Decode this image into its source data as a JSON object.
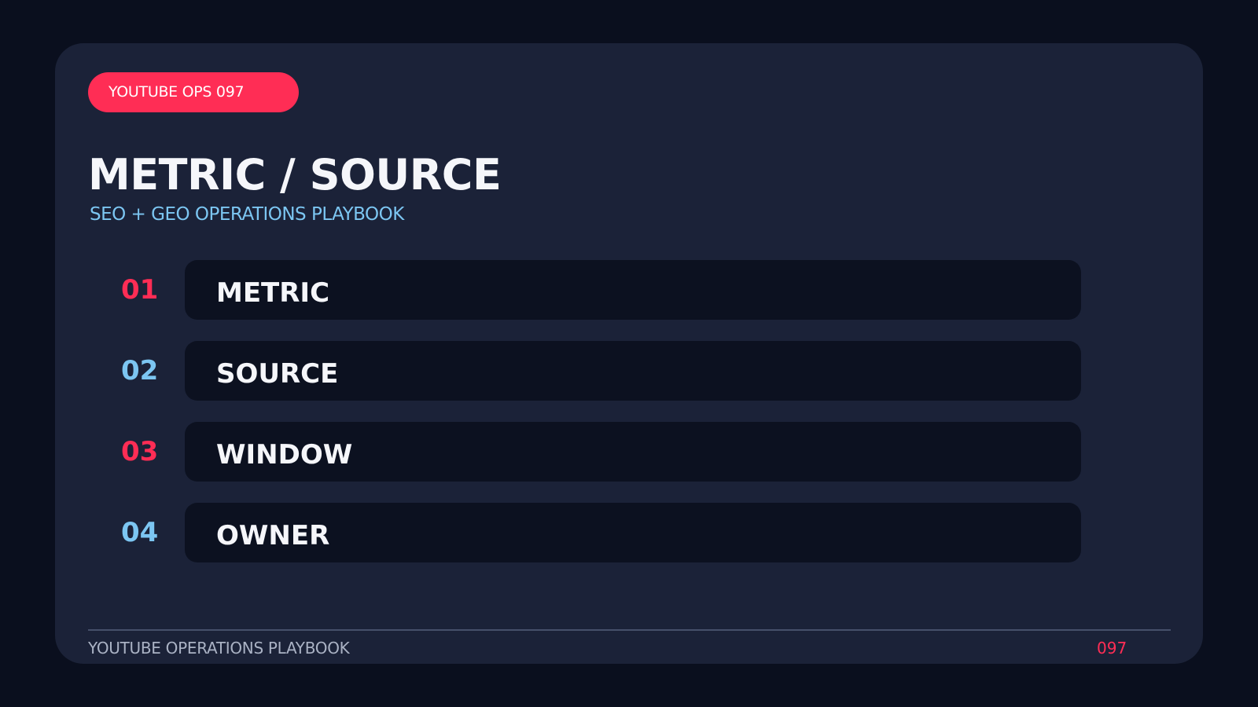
{
  "badge": "YOUTUBE OPS 097",
  "title": "METRIC / SOURCE",
  "subtitle": "SEO + GEO OPERATIONS PLAYBOOK",
  "items": [
    {
      "number": "01",
      "label": "METRIC",
      "number_color": "#ff2d55"
    },
    {
      "number": "02",
      "label": "SOURCE",
      "number_color": "#7cc6f2"
    },
    {
      "number": "03",
      "label": "WINDOW",
      "number_color": "#ff2d55"
    },
    {
      "number": "04",
      "label": "OWNER",
      "number_color": "#7cc6f2"
    }
  ],
  "footer": {
    "left": "YOUTUBE OPERATIONS PLAYBOOK",
    "right": "097"
  },
  "colors": {
    "background": "#0a0f1e",
    "card": "#1b2238",
    "accent": "#ff2d55",
    "secondary": "#7cc6f2"
  }
}
